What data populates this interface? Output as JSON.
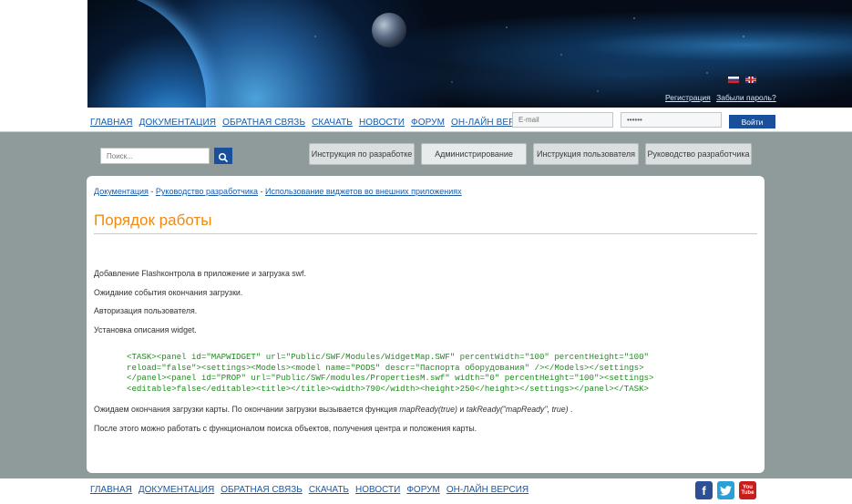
{
  "header": {
    "languages": [
      "ru",
      "en"
    ],
    "register_label": "Регистрация",
    "forgot_label": "Забыли пароль?"
  },
  "nav": {
    "items": [
      "ГЛАВНАЯ",
      "ДОКУМЕНТАЦИЯ",
      "ОБРАТНАЯ СВЯЗЬ",
      "СКАЧАТЬ",
      "НОВОСТИ",
      "ФОРУМ",
      "ОН-ЛАЙН ВЕРСИЯ"
    ]
  },
  "login": {
    "email_placeholder": "E-mail",
    "password_value": "••••••",
    "submit_label": "Войти"
  },
  "search": {
    "placeholder": "Поиск..."
  },
  "tabs": [
    "Инструкция по разработке",
    "Администрирование",
    "Инструкция пользователя",
    "Руководство разработчика"
  ],
  "breadcrumb": {
    "items": [
      "Документация",
      "Руководство разработчика",
      "Использование виджетов во внешних приложениях"
    ],
    "separator": "-"
  },
  "content": {
    "title": "Порядок работы",
    "steps": [
      "Добавление Flashконтрола в приложение и загрузка swf.",
      "Ожидание события окончания загрузки.",
      "Авторизация пользователя.",
      "Установка описания widget."
    ],
    "code_lines": [
      "<TASK><panel id=\"MAPWIDGET\" url=\"Public/SWF/Modules/WidgetMap.SWF\" percentWidth=\"100\" percentHeight=\"100\"",
      "reload=\"false\"><settings><Models><model name=\"PODS\" descr=\"Паспорта оборудования\" /></Models></settings>",
      "</panel><panel id=\"PROP\" url=\"Public/SWF/modules/PropertiesM.swf\" width=\"0\" percentHeight=\"100\"><settings>",
      "<editable>false</editable><title></title><width>790</width><height>250</height></settings></panel></TASK>"
    ],
    "p5_before": "Ожидаем окончания загрузки карты. По окончании загрузки вызывается функция ",
    "p5_fn1": "mapReady(true)",
    "p5_and": " и ",
    "p5_fn2": "takReady(\"mapReady\", true)",
    "p5_end": " .",
    "p6": "После этого можно работать с функционалом поиска объектов, получения центра и положения карты."
  },
  "footer": {
    "nav": [
      "ГЛАВНАЯ",
      "ДОКУМЕНТАЦИЯ",
      "ОБРАТНАЯ СВЯЗЬ",
      "СКАЧАТЬ",
      "НОВОСТИ",
      "ФОРУМ",
      "ОН-ЛАЙН ВЕРСИЯ"
    ],
    "social": {
      "facebook": "f",
      "youtube_top": "You",
      "youtube_bottom": "Tube"
    }
  },
  "colors": {
    "accent_blue": "#1a4f9c",
    "link": "#1a5aa8",
    "title_orange": "#f08a10",
    "code_green": "#1e8c1e",
    "background": "#8f9b9b"
  }
}
